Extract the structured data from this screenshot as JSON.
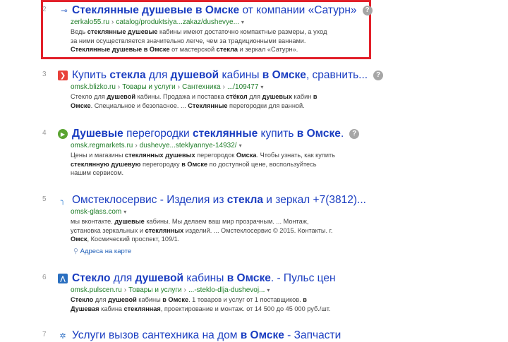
{
  "results": [
    {
      "number": "2",
      "title_parts": [
        {
          "t": "Стеклянные душевые в Омске",
          "b": true
        },
        {
          "t": " от компании «Сатурн»",
          "b": false
        }
      ],
      "url_parts": [
        "zerkalo55.ru",
        "catalog/produktsiya...zakaz/dushevye..."
      ],
      "snippet_lines": [
        [
          {
            "t": "Ведь ",
            "b": false
          },
          {
            "t": "стеклянные душевые",
            "b": true
          },
          {
            "t": " кабины имеют достаточно компактные размеры, а уход",
            "b": false
          }
        ],
        [
          {
            "t": "за ними осуществляется значительно легче, чем за традиционными ваннами.",
            "b": false
          }
        ],
        [
          {
            "t": "Стеклянные душевые в Омске",
            "b": true
          },
          {
            "t": " от мастерской ",
            "b": false
          },
          {
            "t": "стекла",
            "b": true
          },
          {
            "t": " и зеркал «Сатурн».",
            "b": false
          }
        ]
      ]
    },
    {
      "number": "3",
      "title_parts": [
        {
          "t": "Купить ",
          "b": false
        },
        {
          "t": "стекла",
          "b": true
        },
        {
          "t": " для ",
          "b": false
        },
        {
          "t": "душевой",
          "b": true
        },
        {
          "t": " кабины ",
          "b": false
        },
        {
          "t": "в Омске",
          "b": true
        },
        {
          "t": ", сравнить...",
          "b": false
        }
      ],
      "url_parts": [
        "omsk.blizko.ru",
        "Товары и услуги",
        "Сантехника",
        ".../109477"
      ],
      "snippet_lines": [
        [
          {
            "t": "Стекло",
            "b": false
          },
          {
            "t": " для ",
            "b": false
          },
          {
            "t": "душевой",
            "b": true
          },
          {
            "t": " кабины. Продажа и поставка ",
            "b": false
          },
          {
            "t": "стёкол",
            "b": true
          },
          {
            "t": " для ",
            "b": false
          },
          {
            "t": "душевых",
            "b": true
          },
          {
            "t": " кабин ",
            "b": false
          },
          {
            "t": "в",
            "b": true
          }
        ],
        [
          {
            "t": "Омске",
            "b": true
          },
          {
            "t": ". Специальное и безопасное. ... ",
            "b": false
          },
          {
            "t": "Стеклянные",
            "b": true
          },
          {
            "t": " перегородки для ванной.",
            "b": false
          }
        ]
      ]
    },
    {
      "number": "4",
      "title_parts": [
        {
          "t": "Душевые",
          "b": true
        },
        {
          "t": " перегородки ",
          "b": false
        },
        {
          "t": "стеклянные",
          "b": true
        },
        {
          "t": " купить ",
          "b": false
        },
        {
          "t": "в Омске",
          "b": true
        },
        {
          "t": ".",
          "b": false
        }
      ],
      "url_parts": [
        "omsk.regmarkets.ru",
        "dushevye...steklyannye-14932/"
      ],
      "snippet_lines": [
        [
          {
            "t": "Цены и магазины ",
            "b": false
          },
          {
            "t": "стеклянных душевых",
            "b": true
          },
          {
            "t": " перегородок ",
            "b": false
          },
          {
            "t": "Омска",
            "b": true
          },
          {
            "t": ". Чтобы узнать, как купить",
            "b": false
          }
        ],
        [
          {
            "t": "стеклянную душевую",
            "b": true
          },
          {
            "t": " перегородку ",
            "b": false
          },
          {
            "t": "в Омске",
            "b": true
          },
          {
            "t": " по доступной цене, воспользуйтесь",
            "b": false
          }
        ],
        [
          {
            "t": "нашим сервисом.",
            "b": false
          }
        ]
      ]
    },
    {
      "number": "5",
      "title_parts": [
        {
          "t": "Омстеклосервис - Изделия из ",
          "b": false
        },
        {
          "t": "стекла",
          "b": true
        },
        {
          "t": " и зеркал +7(3812)...",
          "b": false
        }
      ],
      "url_parts": [
        "omsk-glass.com"
      ],
      "snippet_lines": [
        [
          {
            "t": "мы вконтакте. ",
            "b": false
          },
          {
            "t": "душевые",
            "b": true
          },
          {
            "t": " кабины. Мы делаем ваш мир прозрачным. ... Монтаж,",
            "b": false
          }
        ],
        [
          {
            "t": "установка зеркальных и ",
            "b": false
          },
          {
            "t": "стеклянных",
            "b": true
          },
          {
            "t": " изделий. ... Омстеклосервис © 2015. Контакты. г.",
            "b": false
          }
        ],
        [
          {
            "t": "Омск",
            "b": true
          },
          {
            "t": ", Космический проспект, 109/1.",
            "b": false
          }
        ]
      ],
      "address_link": "Адреса на карте"
    },
    {
      "number": "6",
      "title_parts": [
        {
          "t": "Стекло",
          "b": true
        },
        {
          "t": " для ",
          "b": false
        },
        {
          "t": "душевой",
          "b": true
        },
        {
          "t": " кабины ",
          "b": false
        },
        {
          "t": "в Омске",
          "b": true
        },
        {
          "t": ". - Пульс цен",
          "b": false
        }
      ],
      "url_parts": [
        "omsk.pulscen.ru",
        "Товары и услуги",
        "...-steklo-dlja-dushevoj..."
      ],
      "snippet_lines": [
        [
          {
            "t": "Стекло",
            "b": true
          },
          {
            "t": " для ",
            "b": false
          },
          {
            "t": "душевой",
            "b": true
          },
          {
            "t": " кабины ",
            "b": false
          },
          {
            "t": "в Омске",
            "b": true
          },
          {
            "t": ". 1 товаров и услуг от 1 поставщиков. ",
            "b": false
          },
          {
            "t": "в",
            "b": true
          }
        ],
        [
          {
            "t": "Душевая",
            "b": true
          },
          {
            "t": " кабина ",
            "b": false
          },
          {
            "t": "стеклянная",
            "b": true
          },
          {
            "t": ", проектирование и монтаж. от 14 500 до 45 000 руб./шт.",
            "b": false
          }
        ]
      ]
    },
    {
      "number": "7",
      "title_parts": [
        {
          "t": "Услуги вызов сантехника на дом ",
          "b": false
        },
        {
          "t": "в Омске",
          "b": true
        },
        {
          "t": " - Запчасти",
          "b": false
        }
      ]
    }
  ],
  "question_glyph": "?",
  "icons": {
    "r2": "glass-favicon-icon",
    "r3": "blizko-favicon-icon",
    "r4": "regmarkets-favicon-icon",
    "r5": "omskglass-favicon-icon",
    "r6": "pulscen-favicon-icon",
    "r7": "service-favicon-icon"
  },
  "colors": {
    "title": "#1a3dc1",
    "url": "#1f7d28",
    "highlight_border": "#e2202a"
  }
}
